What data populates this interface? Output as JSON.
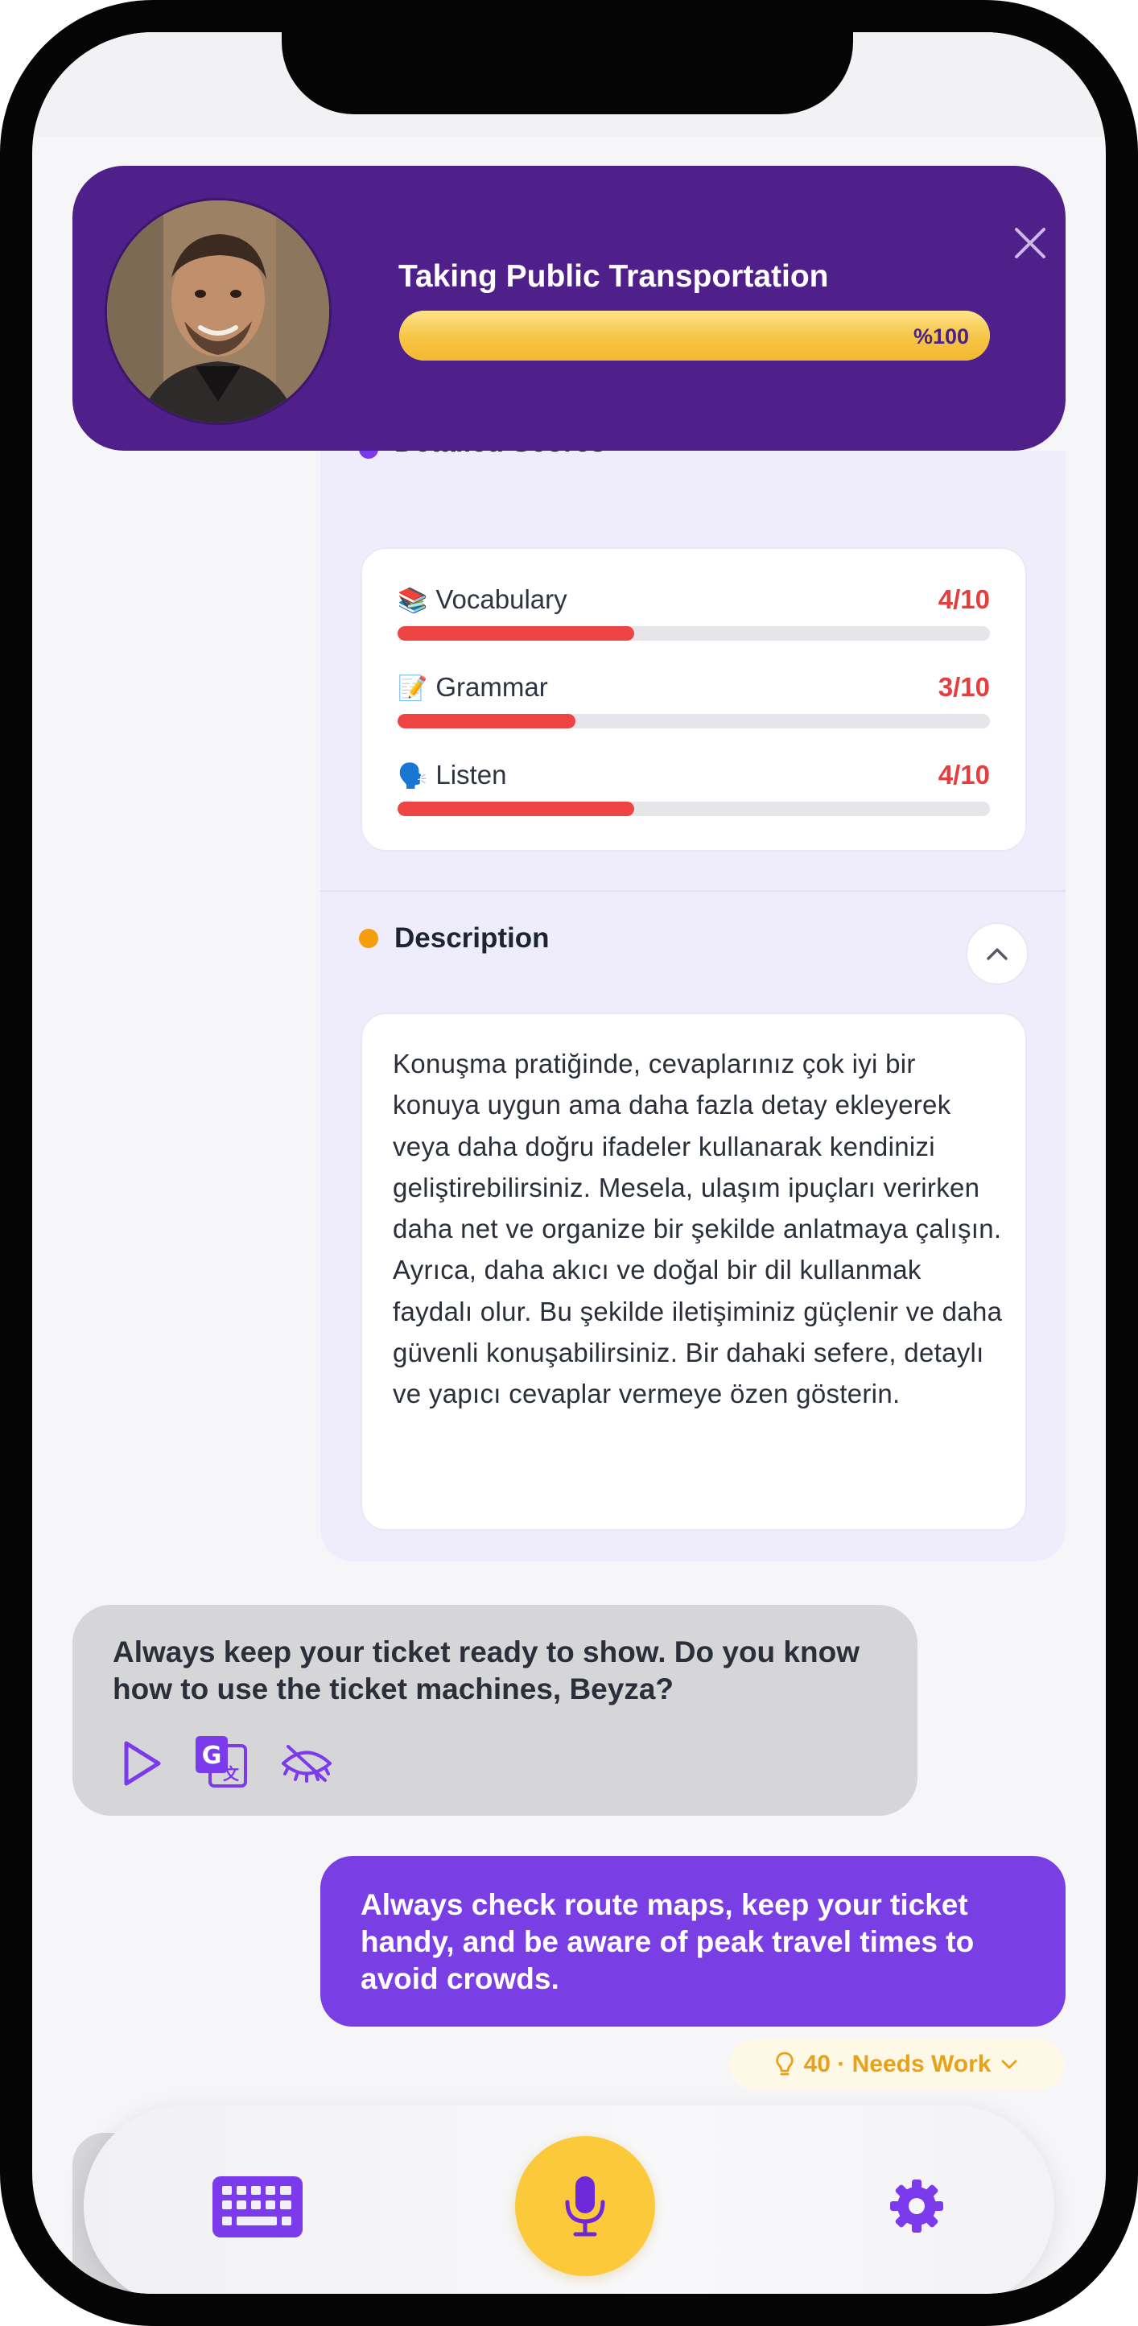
{
  "header": {
    "title": "Taking Public Transportation",
    "progress_label": "%100",
    "progress_percent": 100
  },
  "scores": {
    "section_title": "Detailed Scores",
    "items": [
      {
        "emoji": "📚",
        "label": "Vocabulary",
        "value": "4/10",
        "score": 4,
        "max": 10
      },
      {
        "emoji": "📝",
        "label": "Grammar",
        "value": "3/10",
        "score": 3,
        "max": 10
      },
      {
        "emoji": "🗣️",
        "label": "Listen",
        "value": "4/10",
        "score": 4,
        "max": 10
      }
    ]
  },
  "description": {
    "section_title": "Description",
    "text": "Konuşma pratiğinde, cevaplarınız çok iyi bir konuya uygun ama daha fazla detay ekleyerek veya daha doğru ifadeler kullanarak kendinizi geliştirebilirsiniz. Mesela, ulaşım ipuçları verirken daha net ve organize bir şekilde anlatmaya çalışın. Ayrıca, daha akıcı ve doğal bir dil kullanmak faydalı olur. Bu şekilde iletişiminiz güçlenir ve daha güvenli konuşabilirsiniz. Bir dahaki sefere, detaylı ve yapıcı cevaplar vermeye özen gösterin."
  },
  "chat": {
    "assistant_message": "Always keep your ticket ready to show. Do you know how to use the ticket machines, Beyza?",
    "user_message": "Always check route maps, keep your ticket handy, and be aware of peak travel times to avoid crowds.",
    "user_score_label": "40 · Needs Work"
  },
  "colors": {
    "brand_purple": "#4f1f8a",
    "accent_purple": "#7a3fe4",
    "accent_yellow": "#fbc93a",
    "score_red": "#ef4444",
    "warning_amber": "#e8a21a"
  }
}
